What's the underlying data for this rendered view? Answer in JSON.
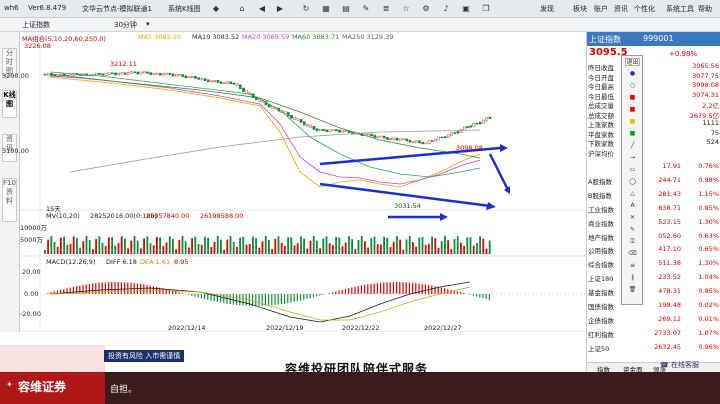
{
  "window": {
    "app": "wh6",
    "version": "Ver6.8.479",
    "doc": "文华云节点-模拟联通1",
    "mode": "系统K线图",
    "menu": [
      "发现",
      "板块",
      "账户",
      "资讯",
      "个性化",
      "系统工具",
      "帮助"
    ]
  },
  "toolbar": {
    "symbol": "上证指数",
    "period": "30分钟"
  },
  "lefttabs": [
    "分时图",
    "K线图",
    "资讯",
    "F10资料"
  ],
  "chart": {
    "ma_title": "MA组合(5,10,20,60,250,0)",
    "ma5": "MA5 3092.20",
    "ma10": "MA10 3083.52",
    "ma20": "MA20 3069.59",
    "ma60": "MA60 3083.71",
    "ma250": "MA250 3129.39",
    "high_label": "3226.08",
    "peak2": "3212.11",
    "low_label": "3031.54",
    "last_label": "3098.08",
    "y_labels": [
      "3200.00",
      "3100.00"
    ],
    "days_label": "15天",
    "vol_title": "MV(10,20)",
    "vol_vals": [
      "28252016.00(0:100)",
      "25057840.00",
      "26198588.00"
    ],
    "vol_y": [
      "10000万",
      "5000万"
    ],
    "macd_title": "MACD(12,26,9)",
    "macd_diff": "DIFF 6.18",
    "macd_dea": "DEA 1.61",
    "macd_val": "8.95",
    "macd_y": [
      "20.00",
      "0.00",
      "-20.00"
    ],
    "dates": [
      "2022/12/14",
      "2022/12/19",
      "2022/12/22",
      "2022/12/27"
    ]
  },
  "right": {
    "title": "上证指数",
    "code": "999001",
    "price": "3095.5",
    "change": "+0.98%",
    "rows": [
      {
        "k": "昨日收盘",
        "v": "3065.56"
      },
      {
        "k": "今日开盘",
        "v": "3077.75"
      },
      {
        "k": "今日最高",
        "v": "3098.08"
      },
      {
        "k": "今日最低",
        "v": "3074.31"
      },
      {
        "k": "总成交量",
        "v": "2.2亿"
      },
      {
        "k": "总成交额",
        "v": "2679.5亿"
      },
      {
        "k": "上涨家数",
        "v": "1111"
      },
      {
        "k": "平盘家数",
        "v": "75"
      },
      {
        "k": "下跌家数",
        "v": "524"
      },
      {
        "k": "沪深均价",
        "v": ""
      }
    ],
    "sectors": [
      {
        "k": "",
        "v": "17.91",
        "p": "0.76%"
      },
      {
        "k": "A股指数",
        "v": "244.71",
        "p": "0.98%"
      },
      {
        "k": "B股指数",
        "v": "281.43",
        "p": "1.15%"
      },
      {
        "k": "工业指数",
        "v": "838.71",
        "p": "0.85%"
      },
      {
        "k": "商业指数",
        "v": "523.15",
        "p": "1.30%"
      },
      {
        "k": "地产指数",
        "v": "052.60",
        "p": "0.63%"
      },
      {
        "k": "公用指数",
        "v": "417.10",
        "p": "0.65%"
      },
      {
        "k": "综合指数",
        "v": "511.38",
        "p": "1.30%"
      },
      {
        "k": "上证180",
        "v": "233.52",
        "p": "1.04%"
      },
      {
        "k": "基金指数",
        "v": "478.31",
        "p": "0.85%"
      },
      {
        "k": "国债指数",
        "v": "198.48",
        "p": "0.02%"
      },
      {
        "k": "企债指数",
        "v": "269.12",
        "p": "0.01%"
      },
      {
        "k": "红利指数",
        "v": "2733.07",
        "p": "1.07%"
      },
      {
        "k": "上证50",
        "v": "2632.45",
        "p": "0.96%"
      }
    ],
    "tabs": [
      "指数",
      "资金面",
      "领涨"
    ],
    "service": "在线客服",
    "popup_exit": "退出"
  },
  "overlay": {
    "risk": "投资有风险 入市需谨慎",
    "brand": "容维证券",
    "caption": "容维投研团队陪伴式服务",
    "subtitle": "自担。"
  }
}
